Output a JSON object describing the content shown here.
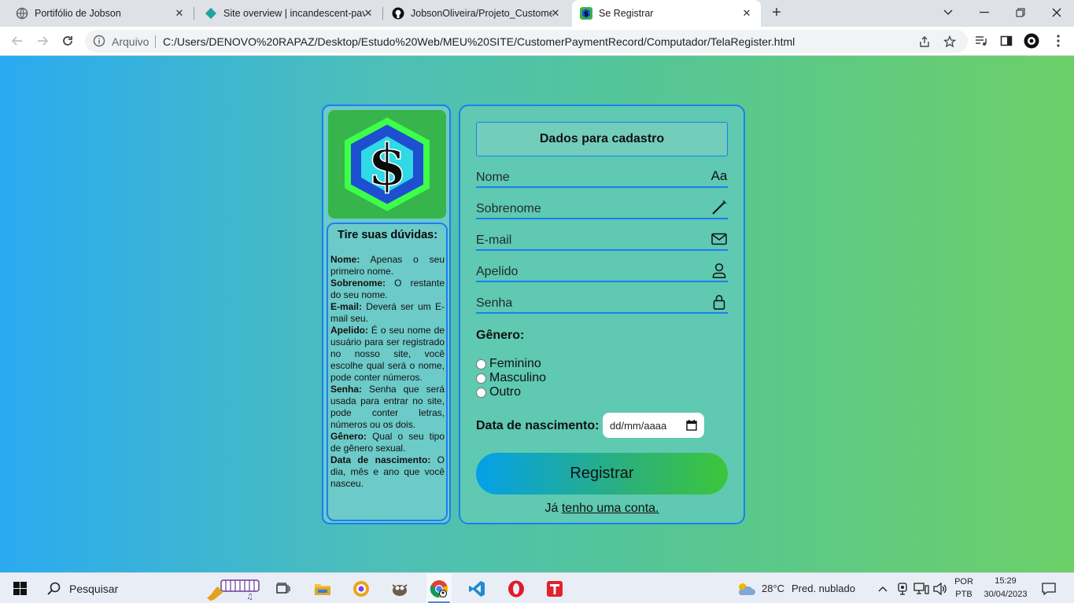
{
  "browser": {
    "tabs": [
      {
        "title": "Portifólio de Jobson",
        "icon": "globe-icon"
      },
      {
        "title": "Site overview | incandescent-pavlo",
        "icon": "netlify-icon"
      },
      {
        "title": "JobsonOliveira/Projeto_Customer",
        "icon": "github-icon"
      },
      {
        "title": "Se Registrar",
        "icon": "site-logo-icon"
      }
    ],
    "close_glyph": "✕",
    "new_tab_glyph": "+",
    "address": {
      "label": "Arquivo",
      "url": "C:/Users/DENOVO%20RAPAZ/Desktop/Estudo%20Web/MEU%20SITE/CustomerPaymentRecord/Computador/TelaRegister.html"
    }
  },
  "sidebar": {
    "help_title": "Tire suas dúvidas:",
    "items": [
      {
        "term": "Nome:",
        "desc": " Apenas o seu primeiro nome."
      },
      {
        "term": "Sobrenome:",
        "desc": " O restante do seu nome."
      },
      {
        "term": "E-mail:",
        "desc": " Deverá ser um E-mail seu."
      },
      {
        "term": "Apelido:",
        "desc": " É o seu nome de usuário para ser registrado no nosso site, você escolhe qual será o nome, pode conter números."
      },
      {
        "term": "Senha:",
        "desc": " Senha que será usada para entrar no site, pode conter letras, números ou os dois."
      },
      {
        "term": "Gênero:",
        "desc": " Qual o seu tipo de gênero sexual."
      },
      {
        "term": "Data de nascimento:",
        "desc": " O dia, mês e ano que você nasceu."
      }
    ]
  },
  "form": {
    "header": "Dados para cadastro",
    "fields": [
      {
        "placeholder": "Nome",
        "icon": "text-aa-icon",
        "icon_text": "Aa"
      },
      {
        "placeholder": "Sobrenome",
        "icon": "pencil-icon"
      },
      {
        "placeholder": "E-mail",
        "icon": "envelope-icon"
      },
      {
        "placeholder": "Apelido",
        "icon": "user-icon"
      },
      {
        "placeholder": "Senha",
        "icon": "lock-icon"
      }
    ],
    "gender_title": "Gênero:",
    "gender_options": [
      "Feminino",
      "Masculino",
      "Outro"
    ],
    "dob_label": "Data de nascimento:",
    "dob_placeholder": "dd/mm/aaaa",
    "register_label": "Registrar",
    "login_prefix": "Já ",
    "login_link": "tenho uma conta."
  },
  "taskbar": {
    "search_text": "Pesquisar",
    "weather": {
      "temp": "28°C",
      "desc": "Pred. nublado"
    },
    "lang": {
      "top": "POR",
      "bottom": "PTB"
    },
    "time": "15:29",
    "date": "30/04/2023"
  },
  "colors": {
    "accent_border": "#1a7ff0",
    "logo_bg": "#37b44b",
    "page_gradient_start": "#2aaaf1",
    "page_gradient_end": "#6cd068"
  }
}
